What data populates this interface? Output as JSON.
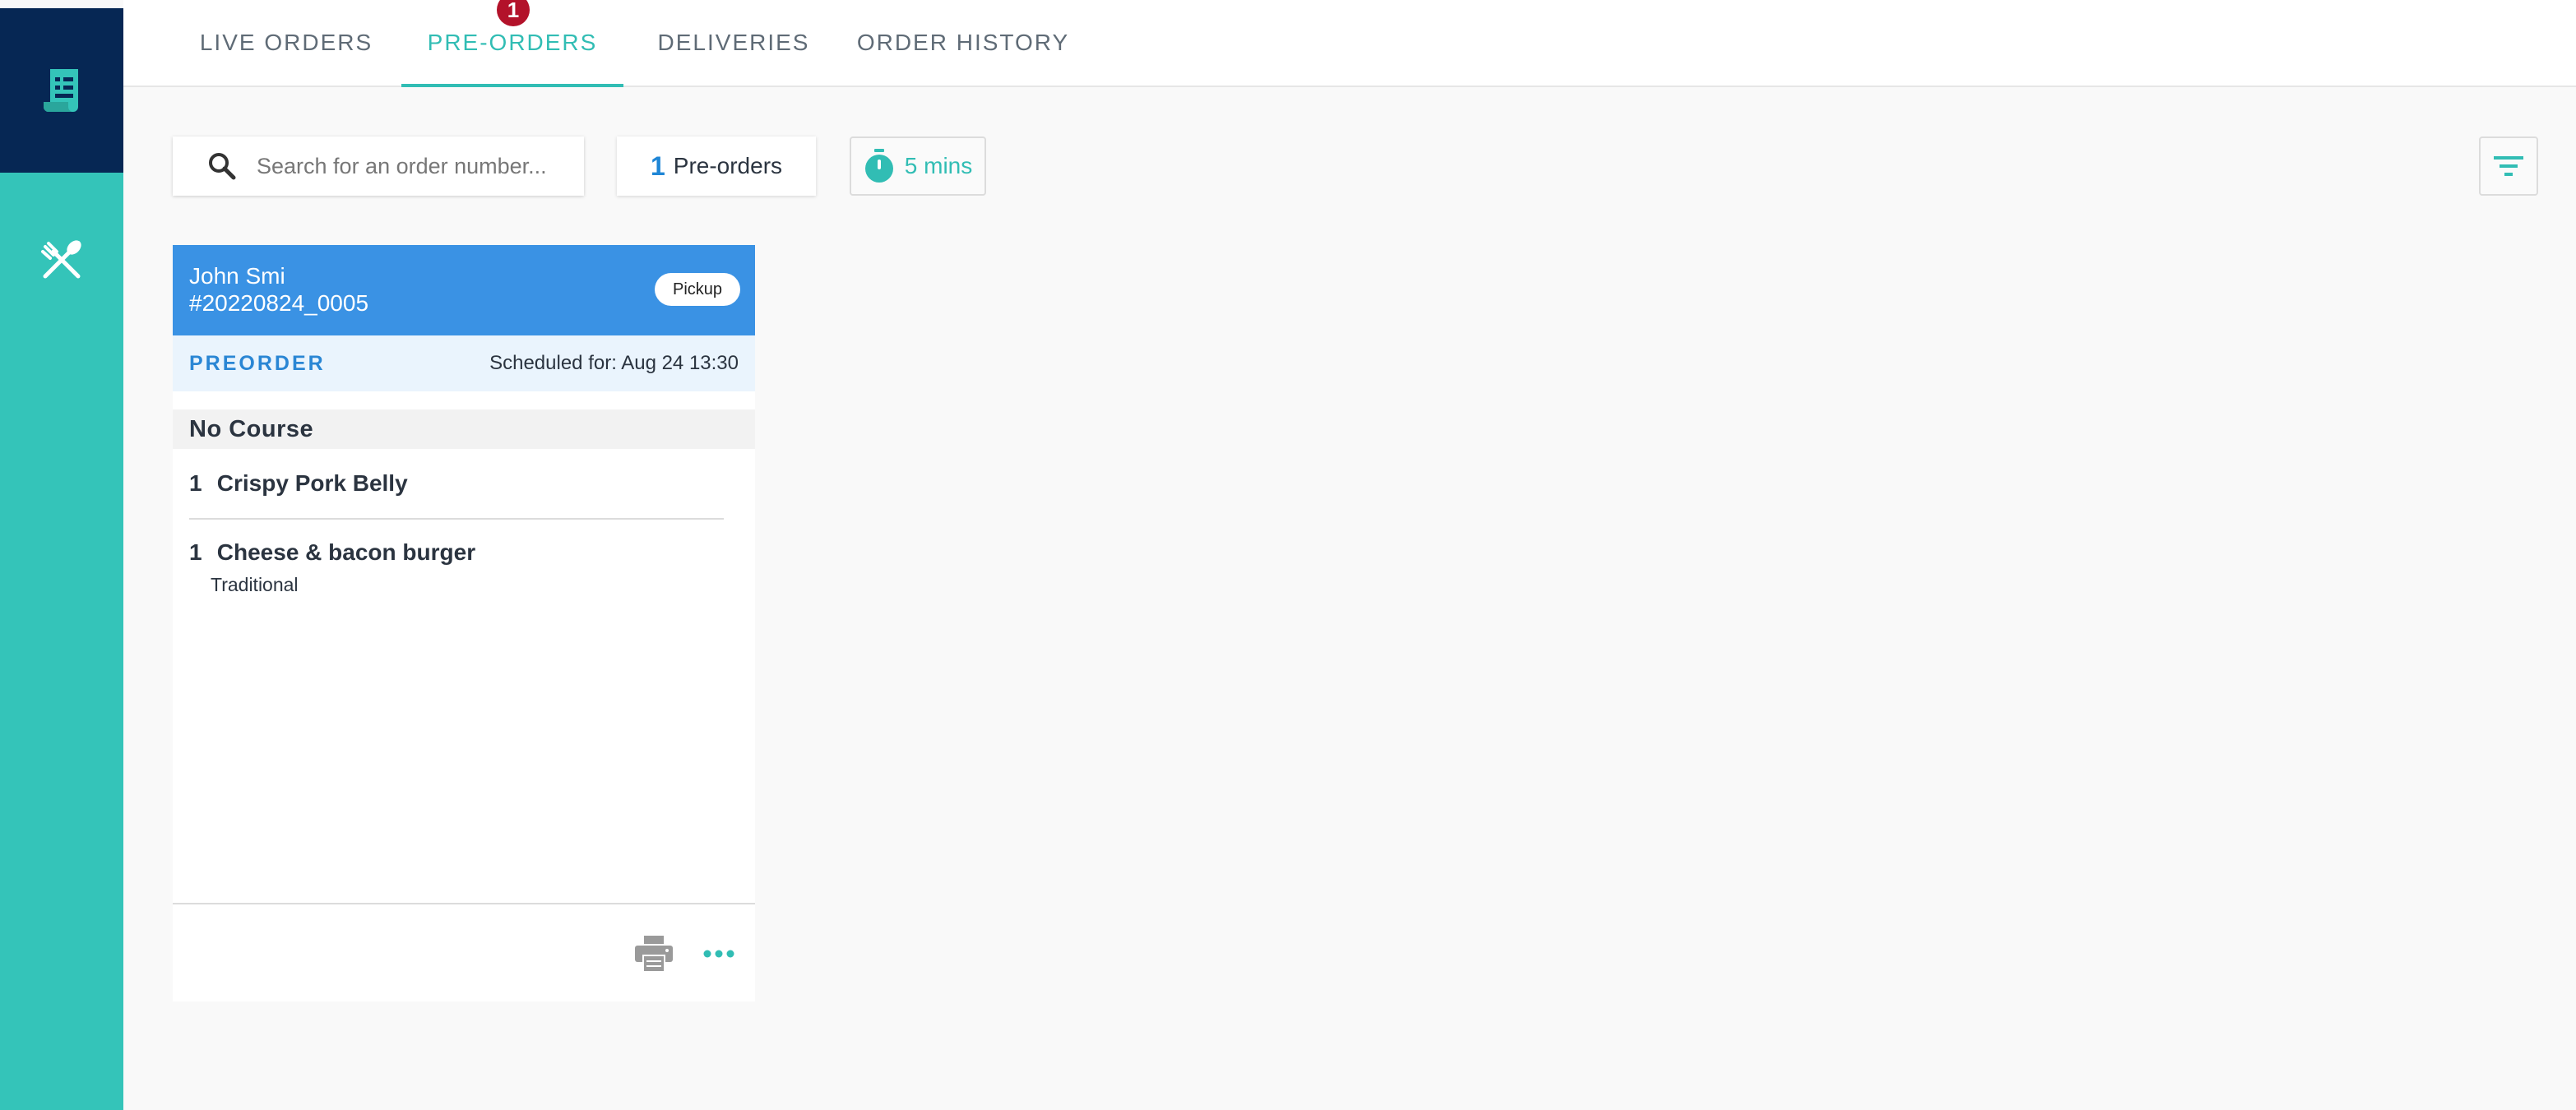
{
  "sidebar": {
    "items": [
      {
        "icon": "receipt-icon",
        "active": true
      },
      {
        "icon": "utensils-icon",
        "active": false
      }
    ],
    "colors": {
      "active_bg": "#062754",
      "bg": "#34c4b9"
    }
  },
  "tabs": [
    {
      "label": "LIVE ORDERS",
      "active": false
    },
    {
      "label": "PRE-ORDERS",
      "active": true,
      "badge": "1"
    },
    {
      "label": "DELIVERIES",
      "active": false
    },
    {
      "label": "ORDER HISTORY",
      "active": false
    }
  ],
  "toolbar": {
    "search_placeholder": "Search for an order number...",
    "search_value": "",
    "count": "1",
    "count_label": "Pre-orders",
    "timer_label": "5 mins",
    "filter_icon": "filter-icon"
  },
  "order": {
    "customer": "John Smi",
    "number": "#20220824_0005",
    "type": "Pickup",
    "status_label": "PREORDER",
    "scheduled": "Scheduled for: Aug 24 13:30",
    "course": "No Course",
    "items": [
      {
        "qty": "1",
        "name": "Crispy Pork Belly",
        "modifier": ""
      },
      {
        "qty": "1",
        "name": "Cheese & bacon burger",
        "modifier": "Traditional"
      }
    ]
  },
  "colors": {
    "accent": "#31bdb4",
    "header_blue": "#3a92e4",
    "badge_red": "#b3122a"
  }
}
